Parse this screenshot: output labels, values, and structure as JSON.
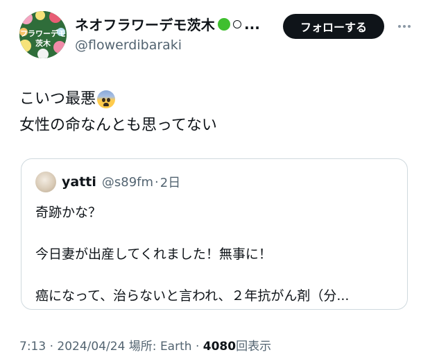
{
  "author": {
    "display_name": "ネオフラワーデモ茨木",
    "name_suffix": "...",
    "handle": "@flowerdibaraki",
    "avatar_text_line1": "フラワーデモ",
    "avatar_text_line2": "茨木"
  },
  "actions": {
    "follow_label": "フォローする"
  },
  "tweet": {
    "line1": "こいつ最悪",
    "line2": "女性の命なんとも思ってない"
  },
  "quoted": {
    "name": "yatti",
    "handle": "@s89fm",
    "sep": "·",
    "age": "2日",
    "line1": "奇跡かな？",
    "line2": "今日妻が出産してくれました！無事に！",
    "line3": "癌になって、治らないと言われ、２年抗がん剤（分..."
  },
  "meta": {
    "time": "7:13",
    "date": "2024/04/24",
    "location_label": "場所:",
    "location": "Earth",
    "views_count": "4080",
    "views_label": "回表示",
    "sep": "·"
  }
}
